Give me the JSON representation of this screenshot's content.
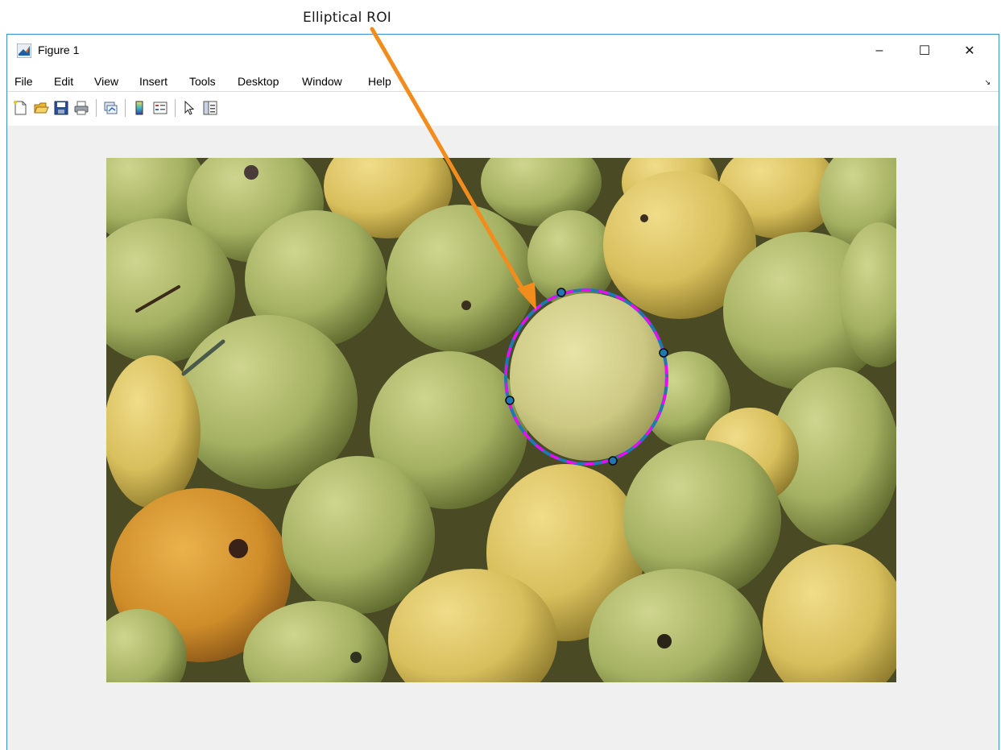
{
  "annotation": {
    "label": "Elliptical ROI"
  },
  "window": {
    "title": "Figure 1",
    "controls": {
      "minimize": "–",
      "maximize": "☐",
      "close": "✕"
    }
  },
  "menu": {
    "items": [
      "File",
      "Edit",
      "View",
      "Insert",
      "Tools",
      "Desktop",
      "Window",
      "Help"
    ],
    "overflow_glyph": "↘"
  },
  "toolbar": {
    "tools": [
      "new-figure",
      "open-file",
      "save-figure",
      "print-figure",
      "link-plot",
      "insert-colorbar",
      "insert-legend",
      "edit-plot",
      "property-inspector"
    ]
  },
  "figure": {
    "image_subject": "pile of green and yellow pears",
    "roi": {
      "type": "ellipse",
      "outline_colors": {
        "edge": "#1f77b4",
        "dash": "#ff00ff"
      },
      "handle_count": 4
    },
    "arrow_color": "#f28c1c"
  }
}
